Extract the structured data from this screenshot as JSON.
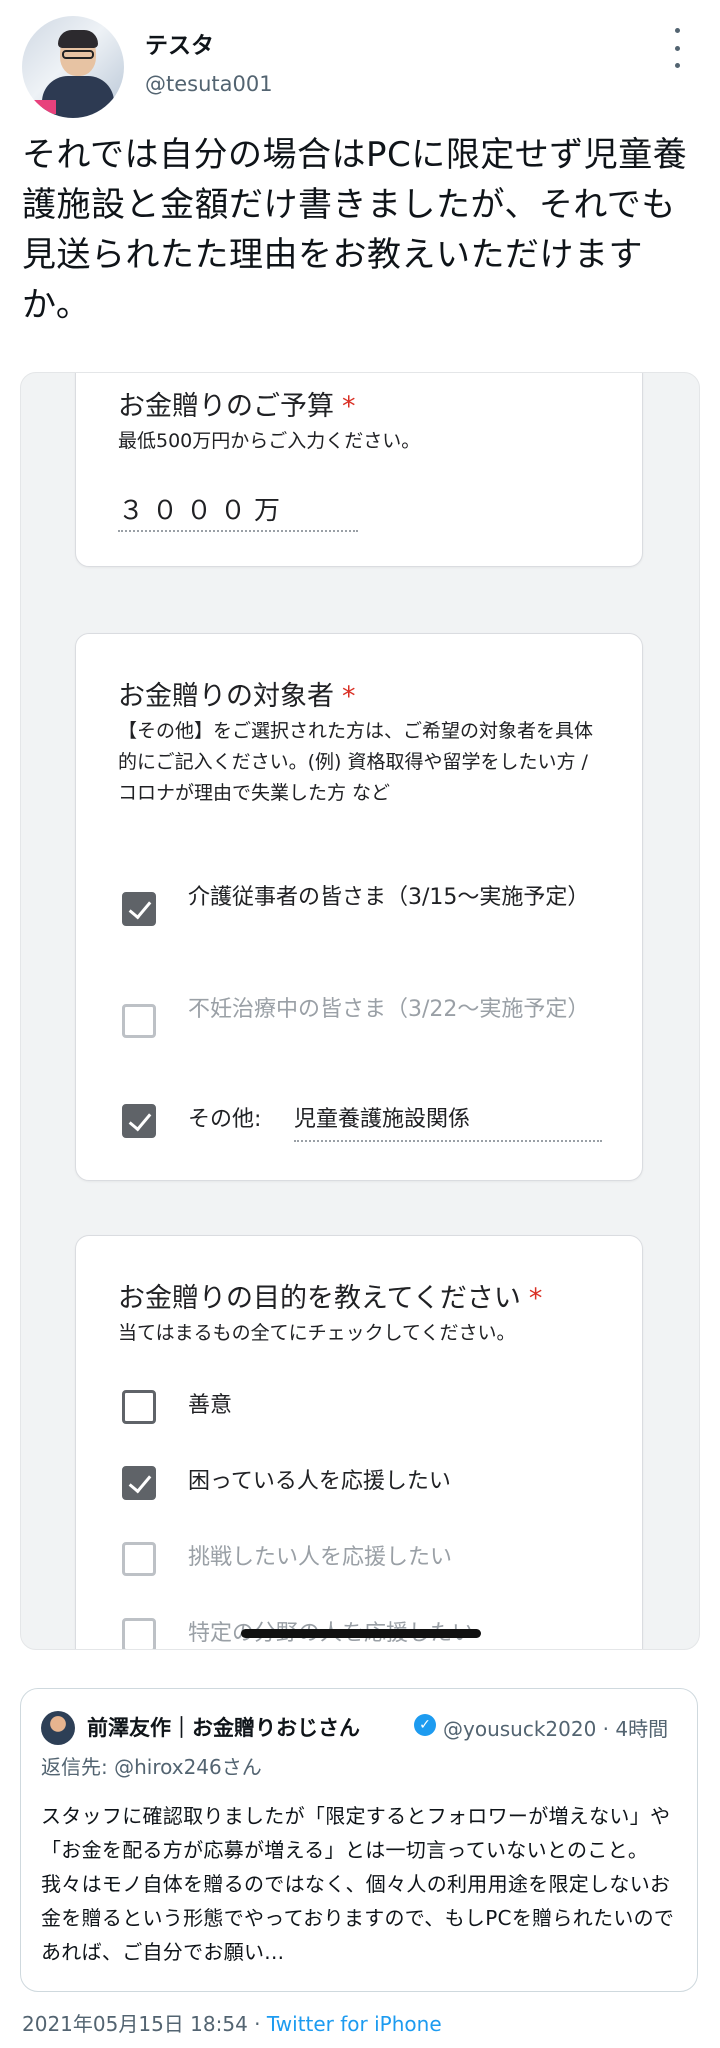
{
  "author": {
    "name": "テスタ",
    "handle": "@tesuta001"
  },
  "tweet": {
    "text": "それでは自分の場合はPCに限定せず児童養護施設と金額だけ書きましたが、それでも見送られたた理由をお教えいただけますか。"
  },
  "form": {
    "budget": {
      "title": "お金贈りのご予算",
      "required_mark": "*",
      "description": "最低500万円からご入力ください。",
      "answer": "３０００万"
    },
    "target": {
      "title": "お金贈りの対象者",
      "required_mark": "*",
      "description": "【その他】をご選択された方は、ご希望の対象者を具体的にご記入ください。(例) 資格取得や留学をしたい方 / コロナが理由で失業した方 など",
      "options": [
        {
          "label": "介護従事者の皆さま（3/15〜実施予定）",
          "checked": true
        },
        {
          "label": "不妊治療中の皆さま（3/22〜実施予定）",
          "checked": false
        },
        {
          "label": "その他:",
          "checked": true,
          "other_value": "児童養護施設関係"
        }
      ]
    },
    "purpose": {
      "title": "お金贈りの目的を教えてください",
      "required_mark": "*",
      "description": "当てはまるもの全てにチェックしてください。",
      "options": [
        {
          "label": "善意",
          "checked": false
        },
        {
          "label": "困っている人を応援したい",
          "checked": true
        },
        {
          "label": "挑戦したい人を応援したい",
          "checked": false
        },
        {
          "label": "特定の分野の人を応援したい",
          "checked": false
        }
      ]
    }
  },
  "quoted": {
    "name": "前澤友作｜お金贈りおじさん",
    "handle_time": "@yousuck2020 · 4時間",
    "reply_prefix": "返信先:",
    "reply_to": "@hirox246さん",
    "body": "スタッフに確認取りましたが「限定するとフォロワーが増えない」や「お金を配る方が応募が増える」とは一切言っていないとのこと。我々はモノ自体を贈るのではなく、個々人の利用用途を限定しないお金を贈るという形態でやっておりますので、もしPCを贈られたいのであれば、ご自分でお願い..."
  },
  "footer": {
    "timestamp": "2021年05月15日 18:54 ·",
    "source": "Twitter for iPhone"
  }
}
